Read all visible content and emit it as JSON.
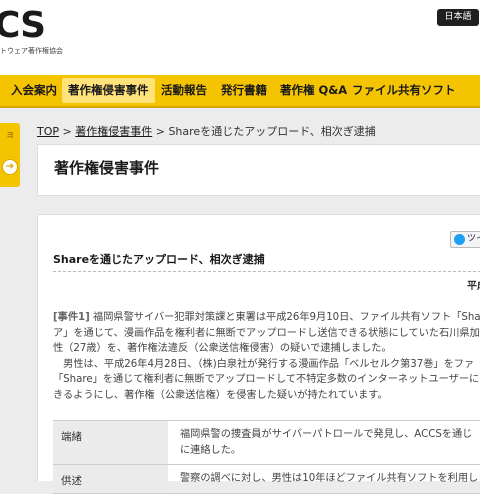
{
  "header": {
    "logo_text": "CS",
    "logo_sub": "トウェア著作権協会",
    "lang_button": "日本語"
  },
  "nav": {
    "items": [
      "入会案内",
      "著作権侵害事件",
      "活動報告",
      "発行書籍",
      "著作権 Q&A",
      "ファイル共有ソフト"
    ]
  },
  "sidebar": {
    "tab_text": "ョ",
    "arrow": "➔"
  },
  "breadcrumb": {
    "top": "TOP",
    "sep1": ">",
    "section": "著作権侵害事件",
    "sep2": ">",
    "current": "Shareを通じたアップロード、相次ぎ逮捕"
  },
  "page_title": "著作権侵害事件",
  "tweet_label": "ツイ",
  "article": {
    "title": "Shareを通じたアップロード、相次ぎ逮捕",
    "date": "平成",
    "heading": "[事件1]",
    "lines": [
      " 福岡県警サイバー犯罪対策課と東署は平成26年9月10日、ファイル共有ソフト「Sha",
      "ア」を通じて、漫画作品を権利者に無断でアップロードし送信できる状態にしていた石川県加",
      "性（27歳）を、著作権法違反（公衆送信権侵害）の疑いで逮捕しました。",
      "　男性は、平成26年4月28日、（株)白泉社が発行する漫画作品「ベルセルク第37巻」をファ",
      "「Share」を通じて権利者に無断でアップロードして不特定多数のインターネットユーザーに",
      "きるようにし、著作権（公衆送信権）を侵害した疑いが持たれています。"
    ]
  },
  "table": {
    "rows": [
      {
        "label": "端緒",
        "lines": [
          "福岡県警の捜査員がサイバーパトロールで発見し、ACCSを通じ",
          "に連絡した。"
        ]
      },
      {
        "label": "供述",
        "lines": [
          "警察の調べに対し、男性は10年ほどファイル共有ソフトを利用し"
        ]
      }
    ]
  }
}
